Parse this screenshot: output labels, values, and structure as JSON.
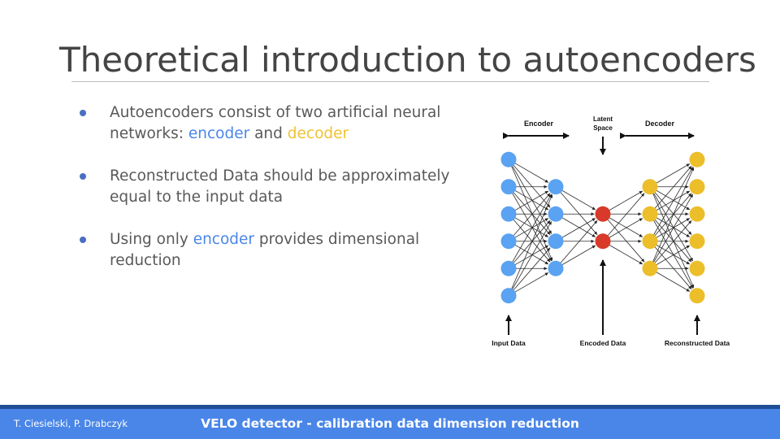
{
  "slide": {
    "title": "Theoretical introduction to autoencoders",
    "bullets": [
      {
        "parts": [
          {
            "text": "Autoencoders consist of two artificial neural networks: ",
            "style": "plain"
          },
          {
            "text": "encoder",
            "style": "enc"
          },
          {
            "text": " and ",
            "style": "plain"
          },
          {
            "text": "decoder",
            "style": "dec"
          }
        ]
      },
      {
        "parts": [
          {
            "text": "Reconstructed Data should be approximately equal to the input data",
            "style": "plain"
          }
        ]
      },
      {
        "parts": [
          {
            "text": "Using only ",
            "style": "plain"
          },
          {
            "text": "encoder",
            "style": "enc"
          },
          {
            "text": " provides dimensional reduction",
            "style": "plain"
          }
        ]
      }
    ]
  },
  "diagram": {
    "encoder_label": "Encoder",
    "latent_label_line1": "Latent",
    "latent_label_line2": "Space",
    "decoder_label": "Decoder",
    "input_label": "Input Data",
    "encoded_label": "Encoded Data",
    "reconstructed_label": "Reconstructed Data",
    "layers": [
      6,
      4,
      2,
      4,
      6
    ],
    "layer_colors": [
      "#5aa2f2",
      "#5aa2f2",
      "#d8392b",
      "#ebbe2a",
      "#ebbe2a"
    ]
  },
  "footer": {
    "authors": "T. Ciesielski, P. Drabczyk",
    "title": "VELO detector - calibration data dimension reduction"
  },
  "colors": {
    "encoder": "#4a86e8",
    "decoder": "#f1c232",
    "bullet": "#4a6fc1",
    "footer_bg": "#4a86e8",
    "footer_line": "#1f4e96"
  }
}
